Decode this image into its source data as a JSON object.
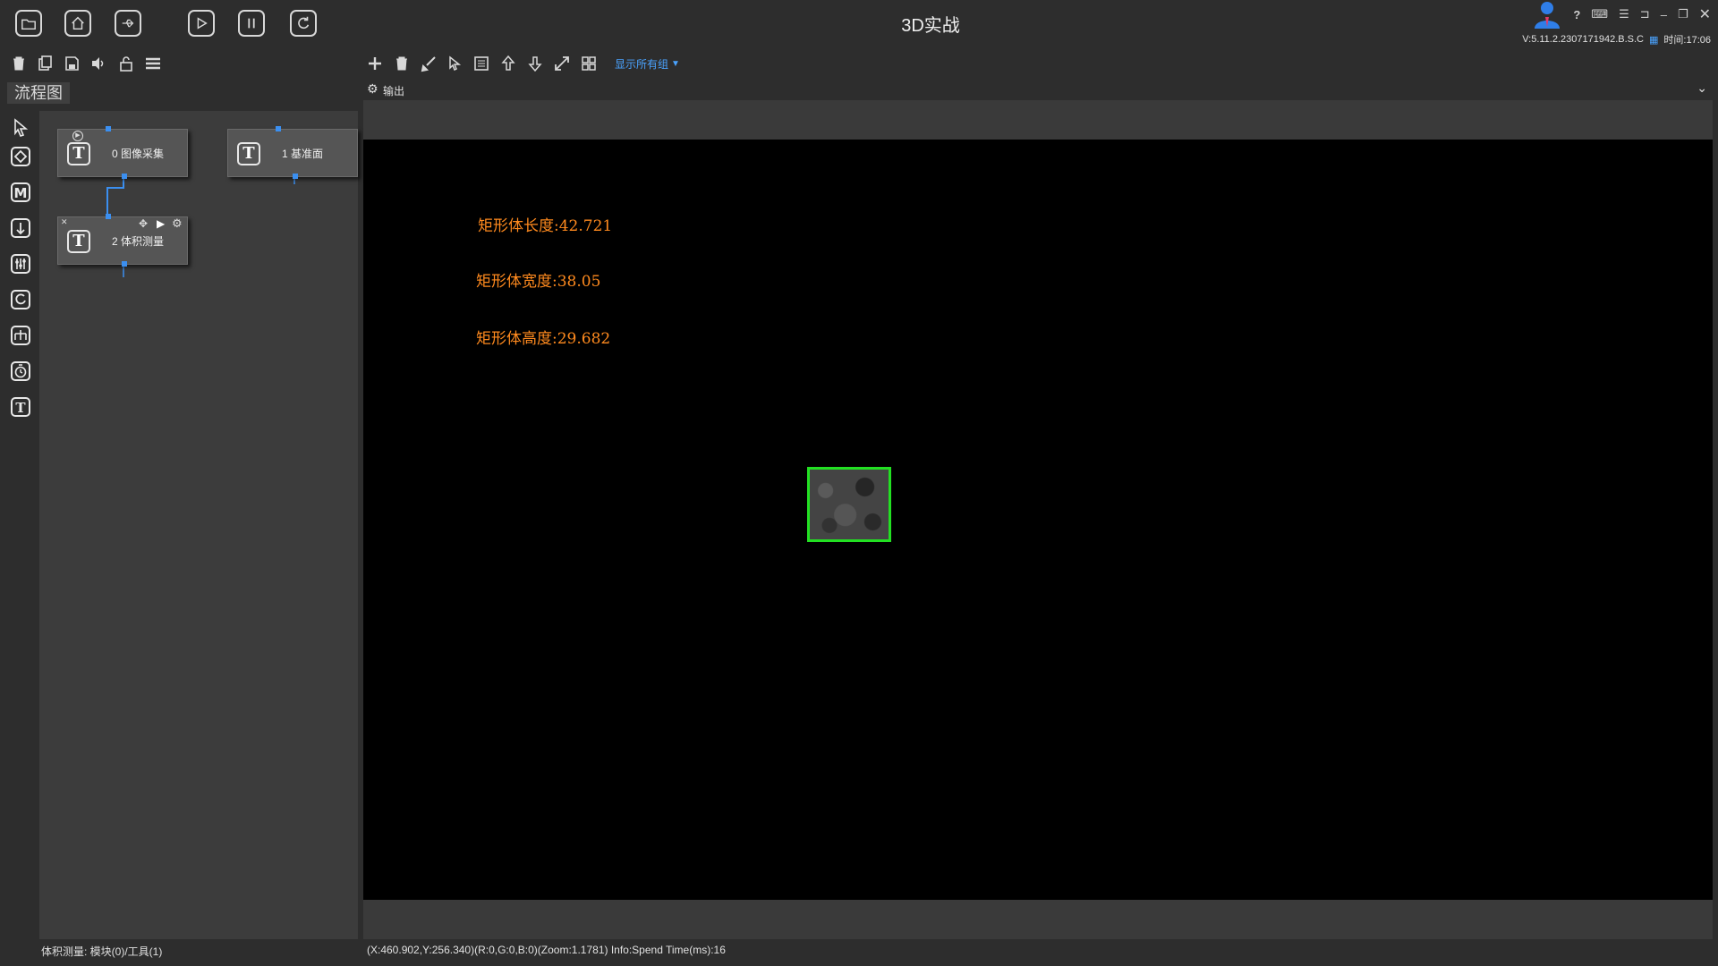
{
  "titlebar": {
    "app_title": "3D实战",
    "help": "?",
    "version": "V:5.11.2.2307171942.B.S.C",
    "time": "时间:17:06"
  },
  "toolbar": {
    "show_groups": "显示所有组"
  },
  "left_panel": {
    "tab_label": "流程图"
  },
  "nodes": [
    {
      "label": "0 图像采集",
      "icon": "T"
    },
    {
      "label": "1 基准面",
      "icon": "T"
    },
    {
      "label": "2 体积测量",
      "icon": "T"
    }
  ],
  "output": {
    "header_label": "输出"
  },
  "measurements": [
    "矩形体长度:42.721",
    "矩形体宽度:38.05",
    "矩形体高度:29.682"
  ],
  "status": {
    "left": "体积测量: 模块(0)/工具(1)",
    "right": "(X:460.902,Y:256.340)(R:0,G:0,B:0)(Zoom:1.1781)  Info:Spend Time(ms):16"
  },
  "colors": {
    "measurement_text": "#ff8a1e",
    "box_outline": "#22e022",
    "accent_link": "#4aa3ff"
  }
}
